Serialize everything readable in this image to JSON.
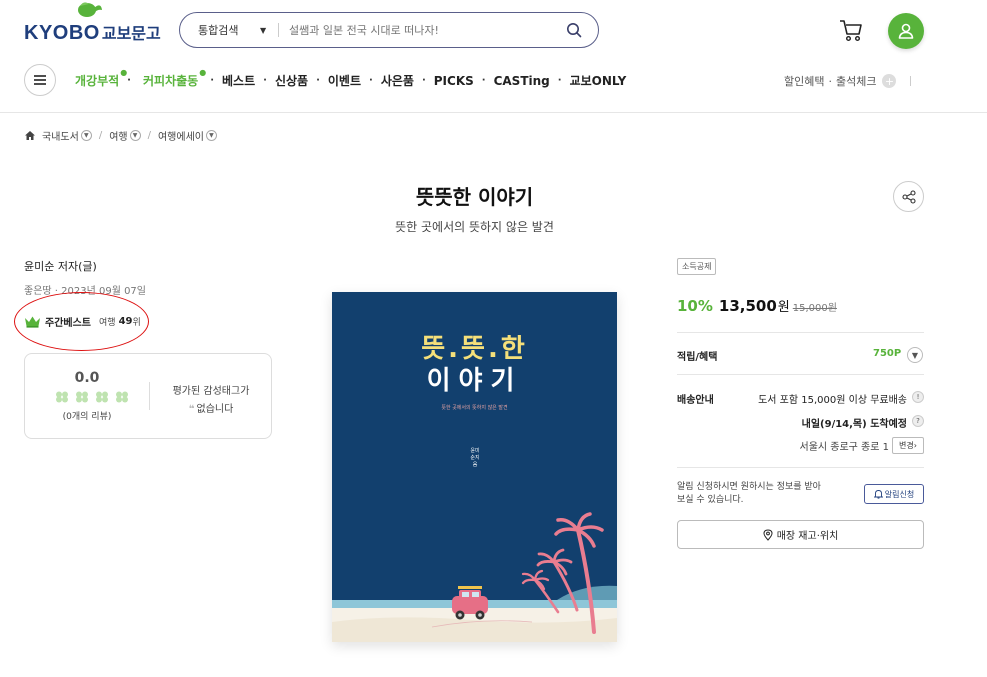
{
  "header": {
    "logo_en": "KYOBO",
    "logo_kr": "교보문고",
    "search_scope": "통합검색",
    "search_placeholder": "설쌤과 일본 전국 시대로 떠나자!"
  },
  "nav": {
    "items": [
      {
        "label": "개강부적",
        "highlight": true,
        "new": true
      },
      {
        "label": "커피차출동",
        "highlight": true,
        "new": true
      },
      {
        "label": "베스트"
      },
      {
        "label": "신상품"
      },
      {
        "label": "이벤트"
      },
      {
        "label": "사은품"
      },
      {
        "label": "PICKS"
      },
      {
        "label": "CASTing"
      },
      {
        "label": "교보ONLY"
      }
    ],
    "right_links": [
      "할인혜택",
      "출석체크"
    ],
    "plus": "+"
  },
  "breadcrumb": [
    "국내도서",
    "여행",
    "여행에세이"
  ],
  "book": {
    "title": "뜻뜻한 이야기",
    "subtitle": "뜻한 곳에서의 뜻하지 않은 발견",
    "author": "윤미순 저자(글)",
    "publisher_info": "좋은땅 · 2023년 09월 07일",
    "bestseller_label": "주간베스트",
    "bestseller_category": "여행",
    "bestseller_rank": "49",
    "bestseller_unit": "위",
    "review_score": "0.0",
    "review_count": "(0개의 리뷰)",
    "tag_title": "평가된 감성태그가",
    "tag_empty": "없습니다",
    "cover_title_line1": "뜻.뜻.한",
    "cover_title_line2": "이야기",
    "cover_subtitle": "뜻한 곳에서의 뜻하지 않은 발견",
    "cover_author": "윤미순지음"
  },
  "purchase": {
    "tax_badge": "소득공제",
    "discount": "10%",
    "price": "13,500",
    "price_unit": "원",
    "original_price": "15,000원",
    "points_label": "적립/혜택",
    "points_value": "750P",
    "shipping_label": "배송안내",
    "shipping_free": "도서 포함 15,000원 이상 무료배송",
    "shipping_eta": "내일(9/14,목) 도착예정",
    "shipping_address": "서울시 종로구 종로 1",
    "change_label": "변경",
    "alert_text": "알림 신청하시면 원하시는 정보를 받아 보실 수 있습니다.",
    "alert_button": "알림신청",
    "store_button": "매장 재고·위치"
  },
  "colors": {
    "brand_blue": "#1f3e7c",
    "brand_green": "#58b33b",
    "annotation_red": "#d11111",
    "cover_blue": "#12406e"
  }
}
